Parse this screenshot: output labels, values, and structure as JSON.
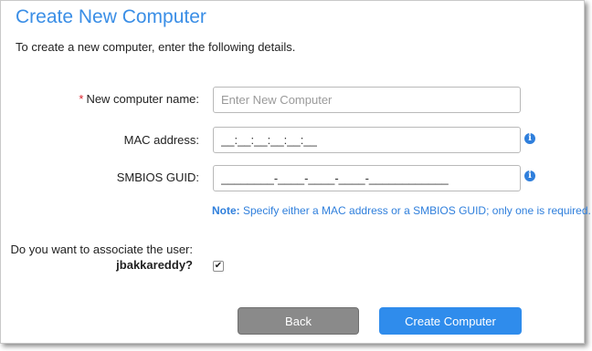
{
  "dialog": {
    "title": "Create New Computer",
    "subtitle": "To create a new computer, enter the following details."
  },
  "form": {
    "required_mark": "*",
    "computer_name": {
      "label": "New computer name:",
      "placeholder": "Enter New Computer",
      "value": ""
    },
    "mac_address": {
      "label": "MAC address:",
      "value": "__:__:__:__:__:__"
    },
    "smbios_guid": {
      "label": "SMBIOS GUID:",
      "value": "________-____-____-____-____________"
    },
    "info_icon": "i",
    "note": {
      "prefix": "Note:",
      "text": " Specify either a MAC address or a SMBIOS GUID; only one is required."
    },
    "associate": {
      "question": "Do you want to associate the user:",
      "username": "jbakkareddy?",
      "checked": true,
      "check_glyph": "✔"
    }
  },
  "buttons": {
    "back": "Back",
    "create": "Create Computer"
  },
  "colors": {
    "accent": "#2f8cec",
    "title": "#3a8ee6",
    "required": "#d9202a",
    "back_button": "#8a8a8a"
  },
  "icons": {
    "info": "info-icon",
    "checkmark": "checkmark-icon"
  }
}
